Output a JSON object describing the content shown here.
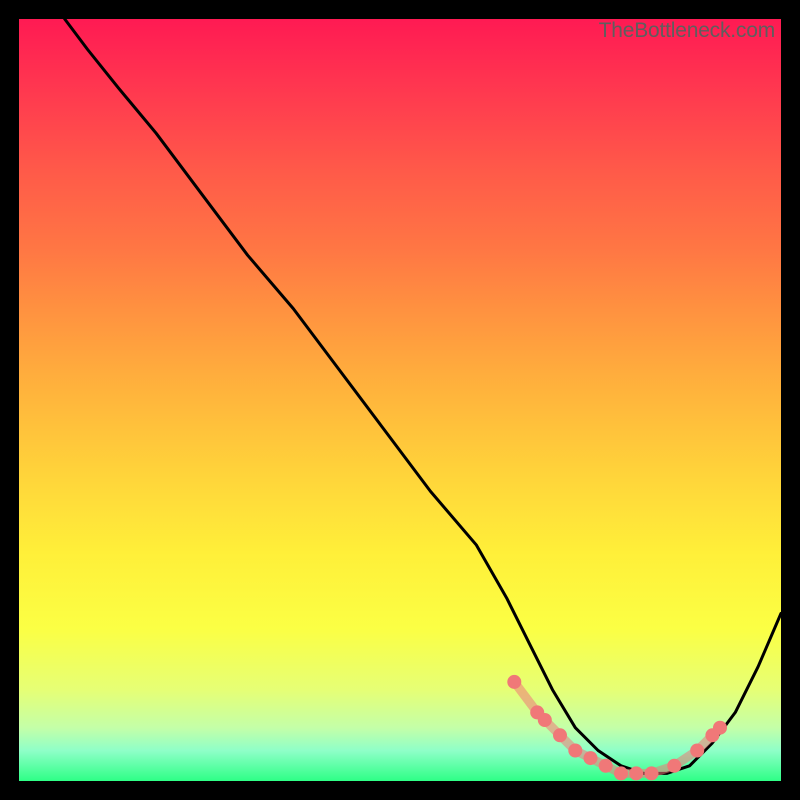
{
  "watermark": "TheBottleneck.com",
  "chart_data": {
    "type": "line",
    "title": "",
    "xlabel": "",
    "ylabel": "",
    "xlim": [
      0,
      100
    ],
    "ylim": [
      0,
      100
    ],
    "series": [
      {
        "name": "bottleneck-curve",
        "color": "#000000",
        "x": [
          6,
          9,
          13,
          18,
          24,
          30,
          36,
          42,
          48,
          54,
          60,
          64,
          67,
          70,
          73,
          76,
          79,
          82,
          85,
          88,
          91,
          94,
          97,
          100
        ],
        "y": [
          100,
          96,
          91,
          85,
          77,
          69,
          62,
          54,
          46,
          38,
          31,
          24,
          18,
          12,
          7,
          4,
          2,
          1,
          1,
          2,
          5,
          9,
          15,
          22
        ]
      },
      {
        "name": "highlight-dots",
        "color": "#f07878",
        "x": [
          65,
          68,
          69,
          71,
          73,
          75,
          77,
          79,
          81,
          83,
          86,
          89,
          91,
          92
        ],
        "y": [
          13,
          9,
          8,
          6,
          4,
          3,
          2,
          1,
          1,
          1,
          2,
          4,
          6,
          7
        ]
      }
    ]
  }
}
